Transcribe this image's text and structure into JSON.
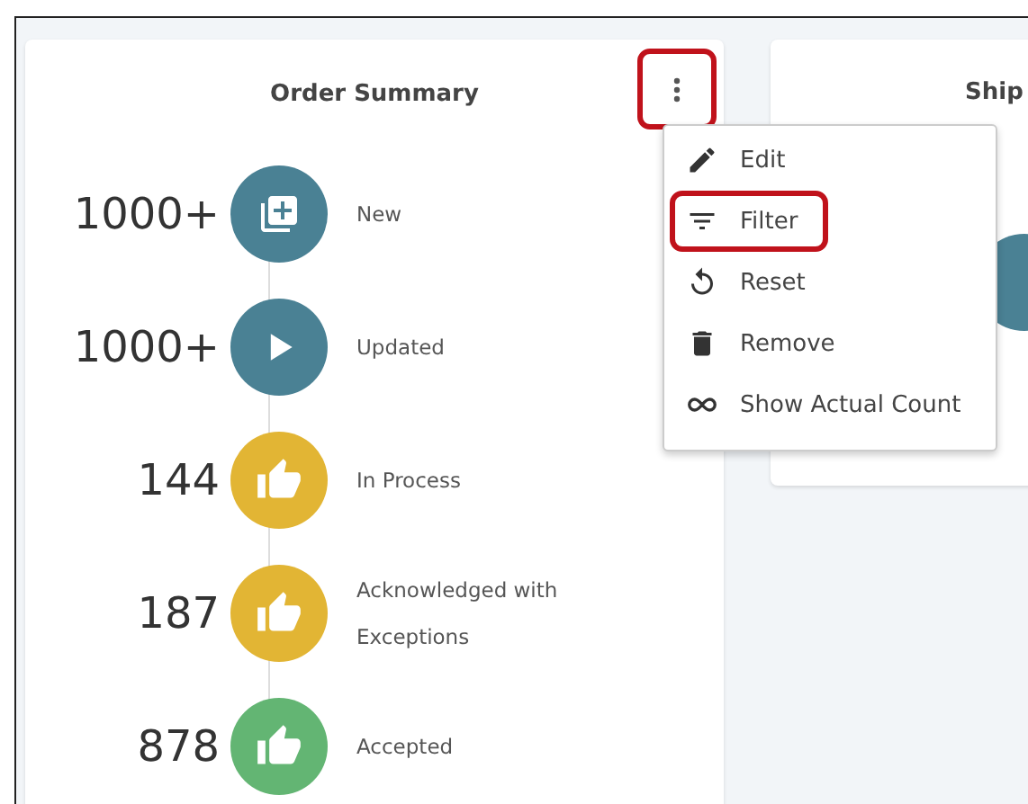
{
  "cards": [
    {
      "title": "Order Summary",
      "menu_button": {
        "highlighted": true
      },
      "rows": [
        {
          "count": "1000+",
          "label": "New",
          "color": "#4a8194"
        },
        {
          "count": "1000+",
          "label": "Updated",
          "color": "#4a8194"
        },
        {
          "count": "144",
          "label": "In Process",
          "color": "#e2b534"
        },
        {
          "count": "187",
          "label": "Acknowledged with Exceptions",
          "color": "#e2b534"
        },
        {
          "count": "878",
          "label": "Accepted",
          "color": "#63b573"
        }
      ]
    },
    {
      "title": "Ship"
    }
  ],
  "menu": {
    "items": [
      {
        "label": "Edit",
        "highlighted": false
      },
      {
        "label": "Filter",
        "highlighted": true
      },
      {
        "label": "Reset",
        "highlighted": false
      },
      {
        "label": "Remove",
        "highlighted": false
      },
      {
        "label": "Show Actual Count",
        "highlighted": false
      }
    ]
  }
}
